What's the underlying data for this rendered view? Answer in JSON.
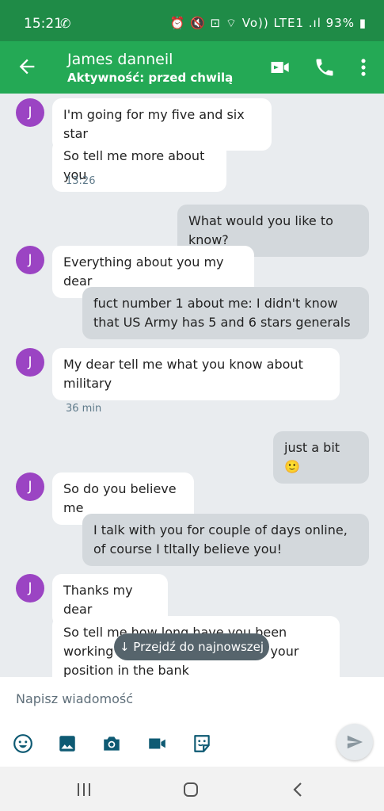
{
  "status": {
    "time": "15:21",
    "left_icon": "call-forward-icon",
    "right_text": "⏰ 🔇 ⊡ ⌔ Vo)) LTE1 .ıl 93% ▮"
  },
  "header": {
    "title": "James danneil",
    "subtitle": "Aktywność: przed chwilą",
    "accent": "#24a955",
    "statusbar_color": "#1f8b47"
  },
  "messages": [
    {
      "side": "in",
      "avatar": "J",
      "text": "I'm going for my five and six star"
    },
    {
      "side": "in",
      "text": "So tell me more about you"
    },
    {
      "timestamp": "13:26"
    },
    {
      "side": "out",
      "text": "What would you like to know?"
    },
    {
      "side": "in",
      "avatar": "J",
      "text": "Everything about you my dear"
    },
    {
      "side": "out",
      "text": "fuct number 1 about me: I didn't know that US Army has 5 and 6 stars generals"
    },
    {
      "side": "in",
      "avatar": "J",
      "text": "My dear tell me what you know about military"
    },
    {
      "timestamp": "36 min"
    },
    {
      "side": "out",
      "text": "just a bit 🙂"
    },
    {
      "side": "in",
      "avatar": "J",
      "text": "So do you believe me"
    },
    {
      "side": "out",
      "text": "I talk with you for couple of days online, of course I tltally believe you!"
    },
    {
      "side": "in",
      "avatar": "J",
      "text": "Thanks my dear"
    },
    {
      "side": "in",
      "text": "So tell me how long have you been working in the bank and what is your position in the bank"
    }
  ],
  "jump_button": "↓ Przejdź do najnowszej",
  "composer": {
    "placeholder": "Napisz wiadomość"
  }
}
